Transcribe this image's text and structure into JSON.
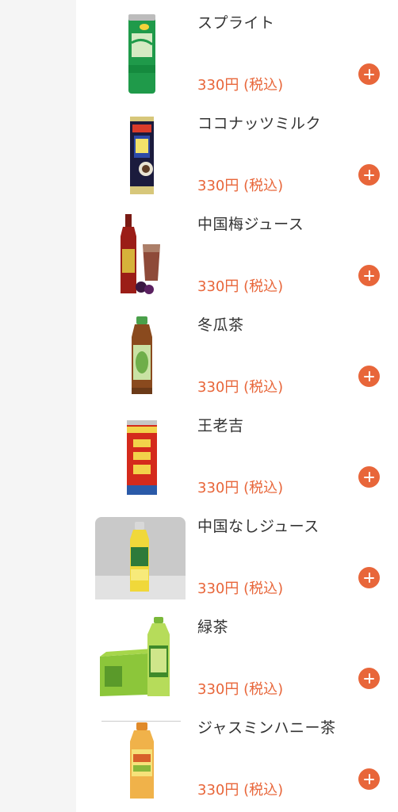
{
  "colors": {
    "accent": "#e8663a",
    "rail": "#f5f5f5",
    "text": "#333333"
  },
  "products": [
    {
      "name": "スプライト",
      "price": "330円 (税込)",
      "image": "sprite-can-image",
      "add_icon": "plus-icon"
    },
    {
      "name": "ココナッツミルク",
      "price": "330円 (税込)",
      "image": "coconut-milk-can-image",
      "add_icon": "plus-icon"
    },
    {
      "name": "中国梅ジュース",
      "price": "330円 (税込)",
      "image": "plum-juice-bottle-image",
      "add_icon": "plus-icon"
    },
    {
      "name": "冬瓜茶",
      "price": "330円 (税込)",
      "image": "winter-melon-tea-bottle-image",
      "add_icon": "plus-icon"
    },
    {
      "name": "王老吉",
      "price": "330円 (税込)",
      "image": "wanglaoji-can-image",
      "add_icon": "plus-icon"
    },
    {
      "name": "中国なしジュース",
      "price": "330円 (税込)",
      "image": "pear-juice-bottle-image",
      "add_icon": "plus-icon"
    },
    {
      "name": "緑茶",
      "price": "330円 (税込)",
      "image": "green-tea-bottle-image",
      "add_icon": "plus-icon"
    },
    {
      "name": "ジャスミンハニー茶",
      "price": "330円 (税込)",
      "image": "jasmine-honey-tea-bottle-image",
      "add_icon": "plus-icon"
    }
  ]
}
